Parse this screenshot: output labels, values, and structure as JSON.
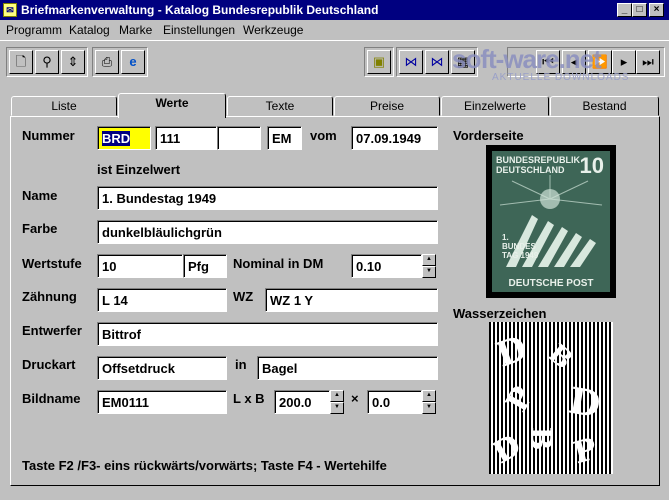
{
  "window": {
    "title": "Briefmarkenverwaltung - Katalog Bundesrepublik Deutschland",
    "controls": [
      "_",
      "□",
      "×"
    ]
  },
  "menu": [
    "Programm",
    "Katalog",
    "Marke",
    "Einstellungen",
    "Werkzeuge"
  ],
  "watermark": {
    "main": "soft-ware.net",
    "sub": "AKTUELLE DOWNLOADS"
  },
  "tabs": [
    "Liste",
    "Werte",
    "Texte",
    "Preise",
    "Einzelwerte",
    "Bestand"
  ],
  "active_tab": "Werte",
  "form": {
    "nummer_label": "Nummer",
    "nummer_prefix": "BRD",
    "nummer_value": "111",
    "nummer_extra": "",
    "nummer_type": "EM",
    "vom_label": "vom",
    "vom_value": "07.09.1949",
    "einzelwert_text": "ist Einzelwert",
    "name_label": "Name",
    "name_value": "1. Bundestag 1949",
    "farbe_label": "Farbe",
    "farbe_value": "dunkelbläulichgrün",
    "wertstufe_label": "Wertstufe",
    "wertstufe_value": "10",
    "wertstufe_unit": "Pfg",
    "nominal_label": "Nominal in DM",
    "nominal_value": "0.10",
    "zaehnung_label": "Zähnung",
    "zaehnung_value": "L 14",
    "wz_label": "WZ",
    "wz_value": "WZ 1 Y",
    "entwerfer_label": "Entwerfer",
    "entwerfer_value": "Bittrof",
    "druckart_label": "Druckart",
    "druckart_value": "Offsetdruck",
    "in_label": "in",
    "druckort_value": "Bagel",
    "bildname_label": "Bildname",
    "bildname_value": "EM0111",
    "lxb_label": "L x B",
    "laenge_value": "200.0",
    "mal_label": "×",
    "breite_value": "0.0"
  },
  "images": {
    "vorderseite_label": "Vorderseite",
    "wasserzeichen_label": "Wasserzeichen",
    "stamp_header": "BUNDESREPUBLIK DEUTSCHLAND",
    "stamp_value": "10",
    "stamp_tag": "1. BUNDES TAG 1949",
    "stamp_footer": "DEUTSCHE POST"
  },
  "status_text": "Taste F2 /F3- eins rückwärts/vorwärts; Taste F4 - Wertehilfe",
  "colors": {
    "titlebar": "#000080",
    "selection": "#000080",
    "highlight": "#ffff00",
    "stamp": "#3e6657"
  }
}
